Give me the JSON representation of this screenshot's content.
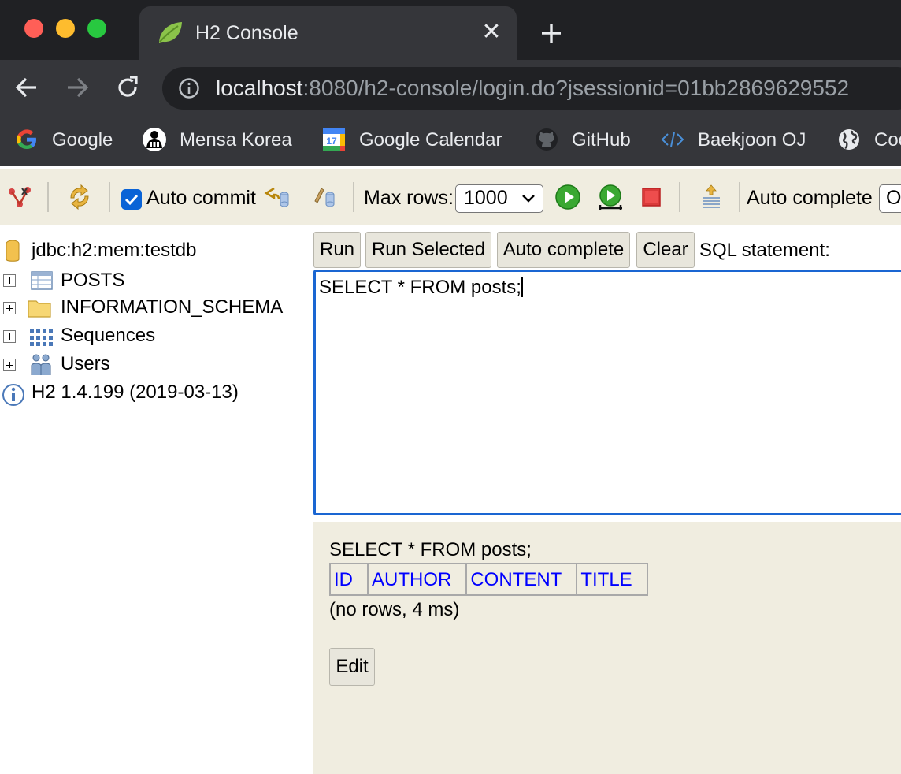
{
  "browser": {
    "tab": {
      "title": "H2 Console"
    },
    "address": {
      "host": "localhost",
      "rest": ":8080/h2-console/login.do?jsessionid=01bb2869629552"
    },
    "bookmarks": [
      {
        "label": "Google",
        "icon": "google-icon"
      },
      {
        "label": "Mensa Korea",
        "icon": "mensa-icon"
      },
      {
        "label": "Google Calendar",
        "icon": "calendar-icon"
      },
      {
        "label": "GitHub",
        "icon": "github-icon"
      },
      {
        "label": "Baekjoon OJ",
        "icon": "code-icon"
      },
      {
        "label": "Coc",
        "icon": "globe-icon"
      }
    ]
  },
  "h2toolbar": {
    "auto_commit_label": "Auto commit",
    "auto_commit_checked": true,
    "max_rows_label": "Max rows:",
    "max_rows_value": "1000",
    "auto_complete_label": "Auto complete",
    "auto_complete_value": "O"
  },
  "tree": {
    "connection": "jdbc:h2:mem:testdb",
    "items": [
      {
        "label": "POSTS",
        "icon": "table-icon"
      },
      {
        "label": "INFORMATION_SCHEMA",
        "icon": "folder-icon"
      },
      {
        "label": "Sequences",
        "icon": "sequence-icon"
      },
      {
        "label": "Users",
        "icon": "users-icon"
      }
    ],
    "version": "H2 1.4.199 (2019-03-13)"
  },
  "query": {
    "buttons": {
      "run": "Run",
      "run_selected": "Run Selected",
      "auto_complete": "Auto complete",
      "clear": "Clear"
    },
    "sql_label": "SQL statement:",
    "sql": "SELECT * FROM posts;"
  },
  "result": {
    "query": "SELECT * FROM posts;",
    "columns": [
      "ID",
      "AUTHOR",
      "CONTENT",
      "TITLE"
    ],
    "status": "(no rows, 4 ms)",
    "edit_label": "Edit"
  },
  "colors": {
    "chrome_dark": "#202124",
    "chrome_toolbar": "#35363a",
    "h2_beige": "#f0ede0",
    "link_blue": "#0000ff",
    "focus_blue": "#1a66d2"
  }
}
